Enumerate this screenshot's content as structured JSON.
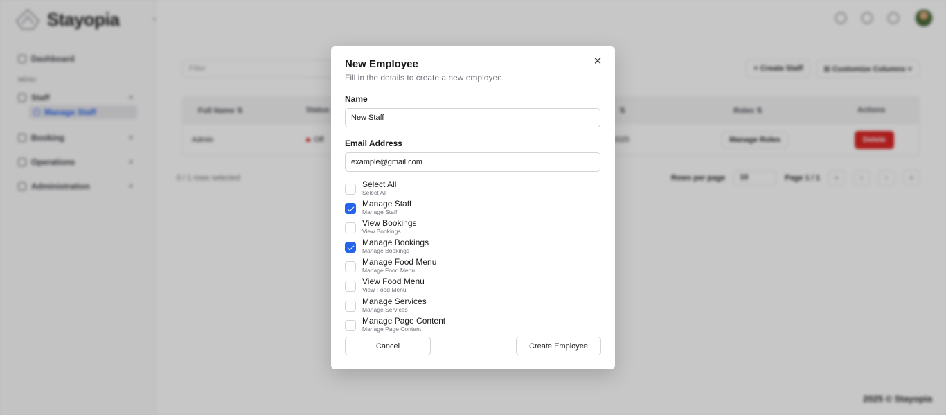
{
  "app": {
    "brand": "Stayopia",
    "copyright": "2025 © Stayopia"
  },
  "sidebar": {
    "items": [
      {
        "label": "Dashboard"
      },
      {
        "label": "Staff"
      },
      {
        "label": "Booking"
      },
      {
        "label": "Operations"
      },
      {
        "label": "Administration"
      }
    ],
    "section_label": "MENU",
    "active_sub": "Manage Staff"
  },
  "toolbar": {
    "filter_placeholder": "Filter",
    "create_staff": "Create Staff",
    "customize_columns": "Customize Columns"
  },
  "table": {
    "columns": [
      "Full Name",
      "Status",
      "Roles",
      "Actions"
    ],
    "rows": [
      {
        "name": "Admin",
        "status": "Off",
        "date": "2025",
        "roles_button": "Manage Roles",
        "action": "Delete"
      }
    ],
    "selection_text": "0 / 1 rows selected",
    "rows_per_page_label": "Rows per page",
    "rows_per_page_value": "10",
    "page_text": "Page 1 / 1"
  },
  "dialog": {
    "title": "New Employee",
    "description": "Fill in the details to create a new employee.",
    "name_label": "Name",
    "name_value": "New Staff",
    "email_label": "Email Address",
    "email_value": "example@gmail.com",
    "permissions": [
      {
        "label": "Select All",
        "sub": "Select All",
        "checked": false
      },
      {
        "label": "Manage Staff",
        "sub": "Manage Staff",
        "checked": true
      },
      {
        "label": "View Bookings",
        "sub": "View Bookings",
        "checked": false
      },
      {
        "label": "Manage Bookings",
        "sub": "Manage Bookings",
        "checked": true
      },
      {
        "label": "Manage Food Menu",
        "sub": "Manage Food Menu",
        "checked": false
      },
      {
        "label": "View Food Menu",
        "sub": "View Food Menu",
        "checked": false
      },
      {
        "label": "Manage Services",
        "sub": "Manage Services",
        "checked": false
      },
      {
        "label": "Manage Page Content",
        "sub": "Manage Page Content",
        "checked": false
      }
    ],
    "cancel_label": "Cancel",
    "create_label": "Create Employee"
  },
  "colors": {
    "accent": "#2563eb",
    "danger": "#dc2626"
  }
}
